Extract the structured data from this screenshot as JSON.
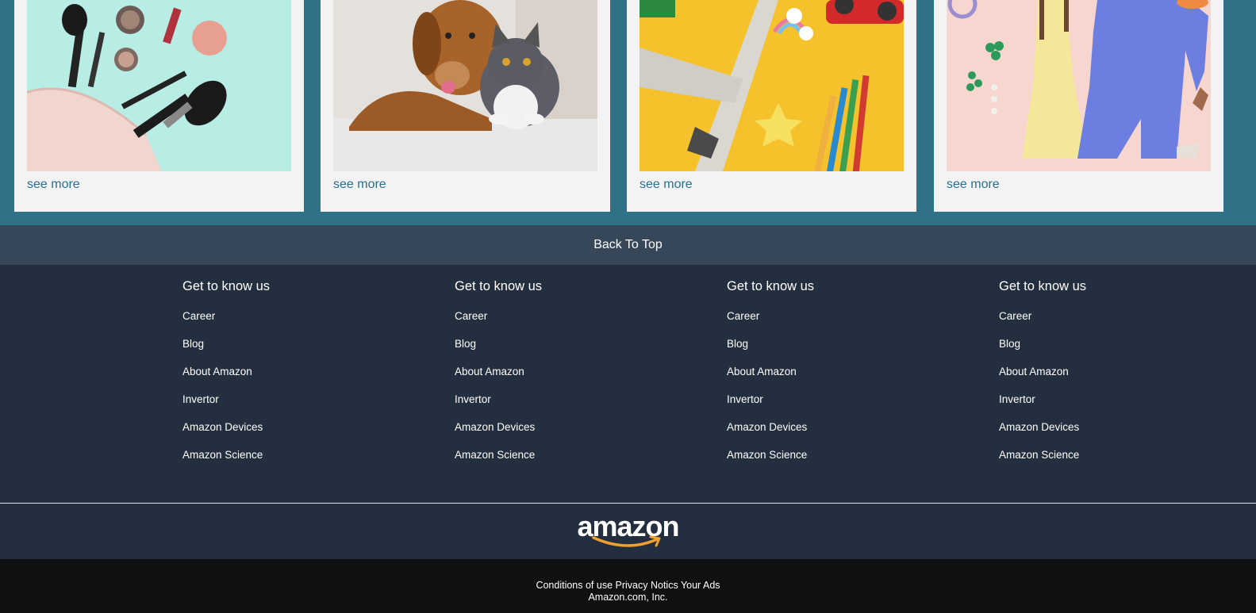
{
  "cards": [
    {
      "image": "cosmetics-makeup-bag",
      "link": "see more"
    },
    {
      "image": "dog-and-cat",
      "link": "see more"
    },
    {
      "image": "toys-airplane-pencils",
      "link": "see more"
    },
    {
      "image": "womens-fashion-outfits",
      "link": "see more"
    }
  ],
  "back_to_top": "Back To Top",
  "footer_columns": [
    {
      "title": "Get to know us",
      "links": [
        "Career",
        "Blog",
        "About Amazon",
        "Invertor",
        "Amazon Devices",
        "Amazon Science"
      ]
    },
    {
      "title": "Get to know us",
      "links": [
        "Career",
        "Blog",
        "About Amazon",
        "Invertor",
        "Amazon Devices",
        "Amazon Science"
      ]
    },
    {
      "title": "Get to know us",
      "links": [
        "Career",
        "Blog",
        "About Amazon",
        "Invertor",
        "Amazon Devices",
        "Amazon Science"
      ]
    },
    {
      "title": "Get to know us",
      "links": [
        "Career",
        "Blog",
        "About Amazon",
        "Invertor",
        "Amazon Devices",
        "Amazon Science"
      ]
    }
  ],
  "logo_text": "amazon",
  "bottom": {
    "links": [
      "Conditions of use",
      "Privacy Notics",
      "Your Ads"
    ],
    "copyright": "Amazon.com, Inc."
  },
  "colors": {
    "card_section_bg": "#2f7186",
    "back_to_top_bg": "#37475a",
    "footer_bg": "#232f3e",
    "bottom_bg": "#0f1111",
    "link_color": "#2a6f8f",
    "logo_smile": "#f0a030"
  }
}
